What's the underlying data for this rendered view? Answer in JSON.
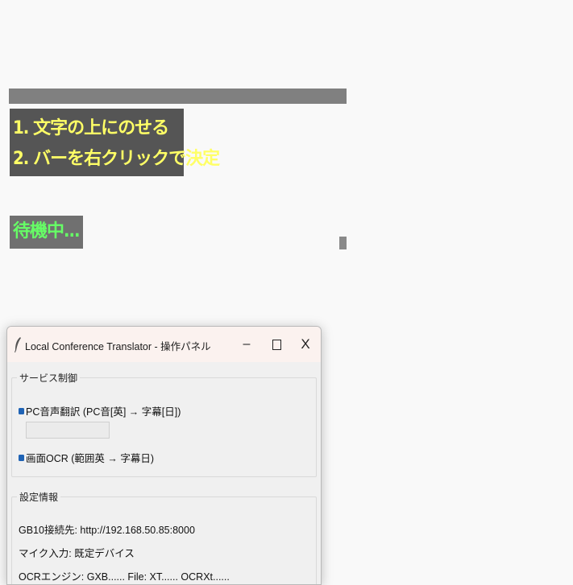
{
  "overlay": {
    "instruction_line1": "1. 文字の上にのせる",
    "instruction_line2": "2. バーを右クリックで決定",
    "status": "待機中..."
  },
  "window": {
    "title": "Local Conference Translator - 操作パネル",
    "minimize_label": "–",
    "close_label": "X",
    "icon": "feather-icon"
  },
  "service_control": {
    "label": "サービス制御",
    "pc_audio_label": "PC音声翻訳 (PC音[英] → 字幕[日])",
    "pc_audio_checked": true,
    "pc_audio_value": "",
    "screen_ocr_label": "画面OCR (範囲英 → 字幕日)",
    "screen_ocr_checked": true
  },
  "settings_info": {
    "label": "設定情報",
    "gb10": "GB10接続先: http://192.168.50.85:8000",
    "mic": "マイク入力: 既定デバイス",
    "ocr": "OCRエンジン: GXB...... File: XT...... OCRXt......"
  },
  "colors": {
    "instruction_text": "#ffff66",
    "status_text": "#66ff66",
    "checkbox": "#1f63b5"
  }
}
